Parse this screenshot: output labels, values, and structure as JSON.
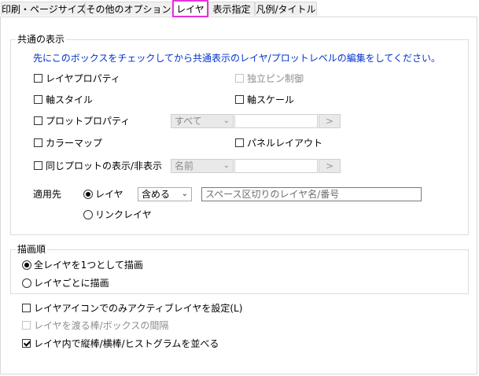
{
  "tabs": [
    {
      "label": "印刷・ページサイズ"
    },
    {
      "label": "その他のオプション"
    },
    {
      "label": "レイヤ"
    },
    {
      "label": "表示指定"
    },
    {
      "label": "凡例/タイトル"
    }
  ],
  "common_group": {
    "title": "共通の表示",
    "hint": "先にこのボックスをチェックしてから共通表示のレイヤ/プロットレベルの編集をしてください。",
    "items": {
      "layer_properties": "レイヤプロパティ",
      "independent_pin": "独立ピン制御",
      "axis_style": "軸スタイル",
      "axis_scale": "軸スケール",
      "plot_properties": "プロットプロパティ",
      "plot_properties_select": "すべて",
      "plot_properties_button": ">",
      "colormap": "カラーマップ",
      "panel_layout": "パネルレイアウト",
      "same_plot_show_hide": "同じプロットの表示/非表示",
      "same_plot_select": "名前",
      "same_plot_button": ">"
    },
    "apply_to": {
      "label": "適用先",
      "radio_layer": "レイヤ",
      "include_select": "含める",
      "layer_names_value": "スペース区切りのレイヤ名/番号",
      "radio_link_layer": "リンクレイヤ"
    }
  },
  "draw_order_group": {
    "title": "描画順",
    "option_all": "全レイヤを1つとして描画",
    "option_each": "レイヤごとに描画"
  },
  "bottom_options": {
    "active_by_icon": "レイヤアイコンでのみアクティブレイヤを設定(L)",
    "bar_gap": "レイヤを渡る棒/ボックスの間隔",
    "side_by_side": "レイヤ内で縦棒/横棒/ヒストグラムを並べる"
  }
}
